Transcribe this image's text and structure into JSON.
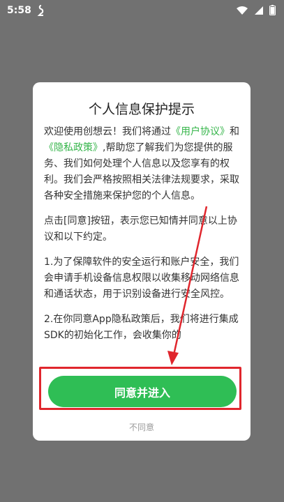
{
  "status_bar": {
    "time": "5:58",
    "icons": [
      "app-notification-icon",
      "wifi-icon",
      "signal-icon",
      "battery-icon"
    ]
  },
  "dialog": {
    "title": "个人信息保护提示",
    "para1": {
      "prefix": "欢迎使用创想云！我们将通过",
      "link1": "《用户协议》",
      "mid": "和",
      "link2": "《隐私政策》",
      "suffix": ",帮助您了解我们为您提供的服务、我们如何处理个人信息以及您享有的权利。我们会严格按照相关法律法规要求，采取各种安全措施来保护您的个人信息。"
    },
    "para2": "点击[同意]按钮，表示您已知情并同意以上协议和以下约定。",
    "para3": "1.为了保障软件的安全运行和账户安全，我们会申请手机设备信息权限以收集移动网络信息和通话状态，用于识别设备进行安全风控。",
    "para4": "2.在你同意App隐私政策后，我们将进行集成SDK的初始化工作，会收集你的",
    "agree_label": "同意并进入",
    "disagree_label": "不同意"
  },
  "colors": {
    "accent": "#2fbe55",
    "link": "#35b54a",
    "annotation": "#e0262d",
    "overlay": "#717171"
  }
}
